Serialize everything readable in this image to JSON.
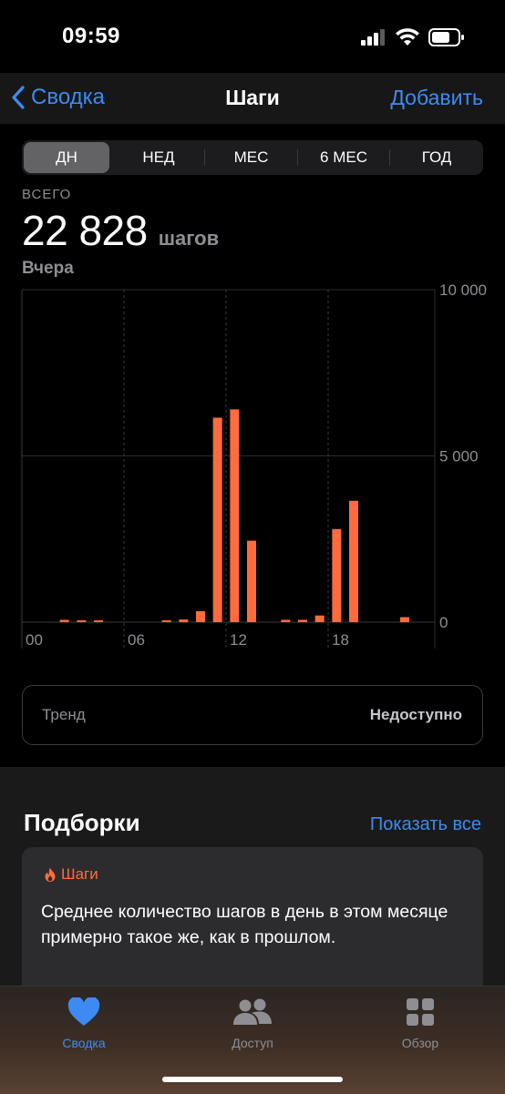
{
  "status": {
    "time": "09:59"
  },
  "nav": {
    "back_label": "Сводка",
    "title": "Шаги",
    "action_label": "Добавить"
  },
  "segments": [
    {
      "label": "ДН",
      "active": true
    },
    {
      "label": "НЕД",
      "active": false
    },
    {
      "label": "МЕС",
      "active": false
    },
    {
      "label": "6 МЕС",
      "active": false
    },
    {
      "label": "ГОД",
      "active": false
    }
  ],
  "summary": {
    "label": "ВСЕГО",
    "value": "22 828",
    "unit": "шагов",
    "date": "Вчера"
  },
  "chart_data": {
    "type": "bar",
    "x_ticks": [
      "00",
      "06",
      "12",
      "18"
    ],
    "y_ticks": [
      "10 000",
      "5 000",
      "0"
    ],
    "ylim": [
      0,
      10000
    ],
    "hours": [
      0,
      1,
      2,
      3,
      4,
      5,
      6,
      7,
      8,
      9,
      10,
      11,
      12,
      13,
      14,
      15,
      16,
      17,
      18,
      19,
      20,
      21,
      22,
      23
    ],
    "values": [
      0,
      0,
      70,
      30,
      20,
      0,
      0,
      0,
      30,
      80,
      330,
      6150,
      6400,
      2450,
      0,
      70,
      70,
      200,
      2800,
      3650,
      0,
      0,
      150,
      0
    ],
    "color": "#ff6b3d",
    "grid": true
  },
  "trend": {
    "label": "Тренд",
    "value": "Недоступно"
  },
  "highlights": {
    "title": "Подборки",
    "show_all": "Показать все",
    "card": {
      "tag": "Шаги",
      "text": "Среднее количество шагов в день в этом месяце примерно такое же, как в прошлом."
    }
  },
  "tabs": [
    {
      "label": "Сводка",
      "icon": "heart-icon",
      "active": true
    },
    {
      "label": "Доступ",
      "icon": "people-icon",
      "active": false
    },
    {
      "label": "Обзор",
      "icon": "grid-icon",
      "active": false
    }
  ],
  "colors": {
    "accent": "#3d8bf2",
    "bar": "#ff6b3d",
    "tab_active": "#3d8bf2",
    "tab_inactive": "#8e8e93"
  }
}
